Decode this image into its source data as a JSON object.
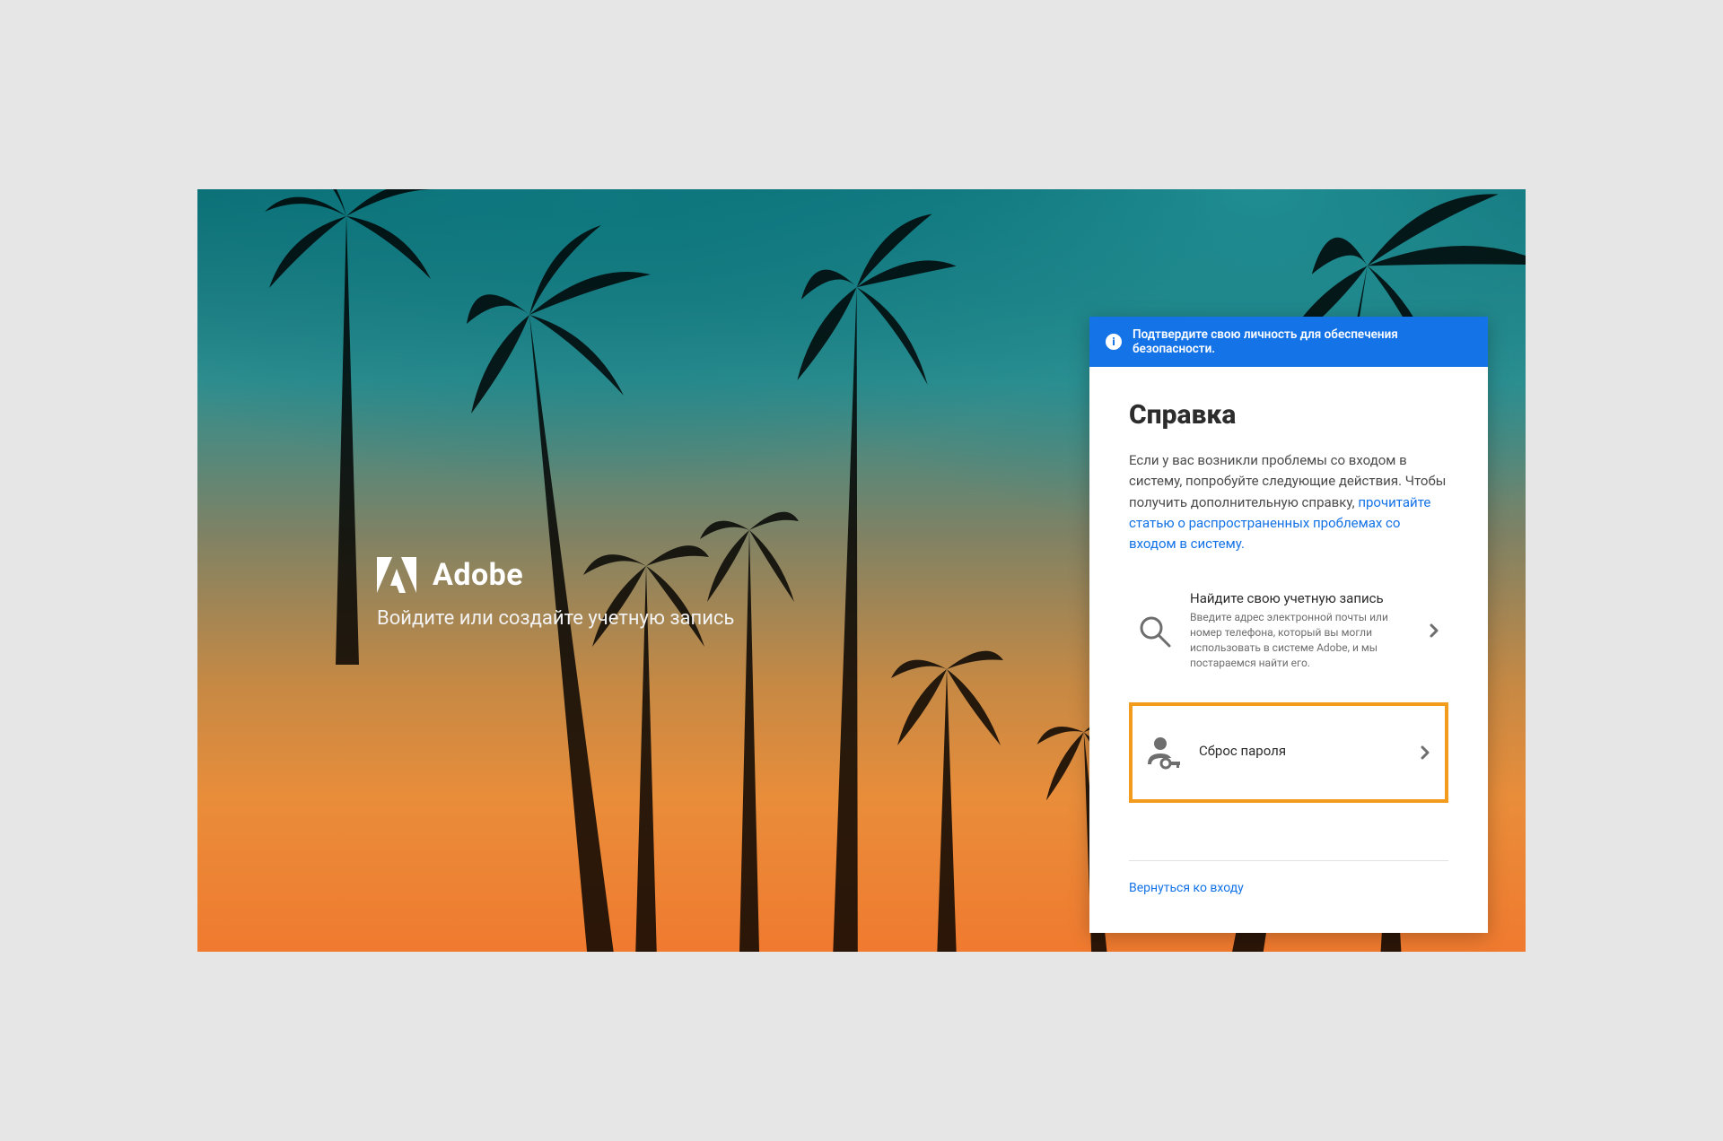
{
  "brand": {
    "name": "Adobe",
    "tagline": "Войдите или создайте учетную запись"
  },
  "banner": {
    "text": "Подтвердите свою личность для обеспечения безопасности."
  },
  "card": {
    "title": "Справка",
    "description_pre": "Если у вас возникли проблемы со входом в систему, попробуйте следующие действия. Чтобы получить дополнительную справку, ",
    "description_link": "прочитайте статью о распространенных проблемах со входом в систему.",
    "back_link": "Вернуться ко входу"
  },
  "options": {
    "find_account": {
      "title": "Найдите свою учетную запись",
      "subtitle": "Введите адрес электронной почты или номер телефона, который вы могли использовать в системе Adobe, и мы постараемся найти его."
    },
    "reset_password": {
      "title": "Сброс пароля"
    }
  }
}
